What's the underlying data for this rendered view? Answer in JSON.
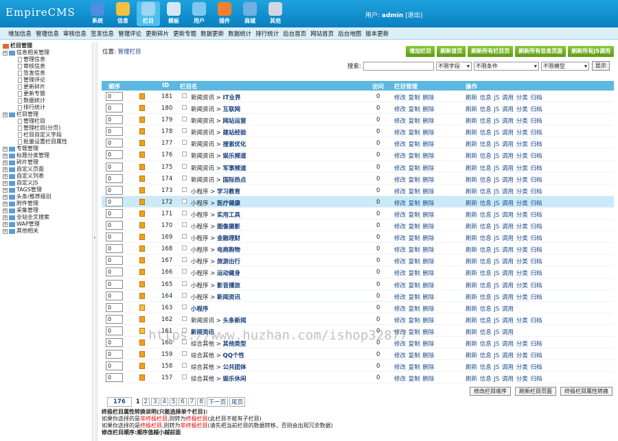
{
  "logo": "EmpireCMS",
  "topnav": [
    {
      "label": "系统",
      "color": "#4a8fe0"
    },
    {
      "label": "信息",
      "color": "#f0c040"
    },
    {
      "label": "栏目",
      "color": "#9dd5f3",
      "active": true
    },
    {
      "label": "模板",
      "color": "#d6e8f5"
    },
    {
      "label": "用户",
      "color": "#7ec8f0"
    },
    {
      "label": "插件",
      "color": "#f08030"
    },
    {
      "label": "商城",
      "color": "#70b0e0"
    },
    {
      "label": "其他",
      "color": "#cfd8e0"
    }
  ],
  "user": {
    "prefix": "用户:",
    "name": "admin",
    "logout": "[退出]"
  },
  "subnav": [
    "增加信息",
    "管理信息",
    "审核信息",
    "签发信息",
    "管理评论",
    "更新碎片",
    "更新专题",
    "数据更新",
    "数据统计",
    "排行统计",
    "后台首页",
    "网站首页",
    "后台地图",
    "版本更新"
  ],
  "sidebar": [
    {
      "t": "栏目管理",
      "lvl": "root"
    },
    {
      "t": "信息相关管理",
      "lvl": "grp"
    },
    {
      "t": "管理信息",
      "lvl": "sub"
    },
    {
      "t": "审核信息",
      "lvl": "sub"
    },
    {
      "t": "签发信息",
      "lvl": "sub"
    },
    {
      "t": "管理评论",
      "lvl": "sub"
    },
    {
      "t": "更新碎片",
      "lvl": "sub"
    },
    {
      "t": "更新专题",
      "lvl": "sub"
    },
    {
      "t": "数据统计",
      "lvl": "sub"
    },
    {
      "t": "排行统计",
      "lvl": "sub"
    },
    {
      "t": "栏目管理",
      "lvl": "grp"
    },
    {
      "t": "管理栏目",
      "lvl": "sub"
    },
    {
      "t": "管理栏目(分页)",
      "lvl": "sub"
    },
    {
      "t": "栏目自定义字段",
      "lvl": "sub"
    },
    {
      "t": "批量设置栏目属性",
      "lvl": "sub"
    },
    {
      "t": "专题管理",
      "lvl": "grp"
    },
    {
      "t": "标题分类管理",
      "lvl": "grp"
    },
    {
      "t": "碎片管理",
      "lvl": "grp"
    },
    {
      "t": "自定义页面",
      "lvl": "grp"
    },
    {
      "t": "自定义列表",
      "lvl": "grp"
    },
    {
      "t": "自定义JS",
      "lvl": "grp"
    },
    {
      "t": "TAGS管理",
      "lvl": "grp"
    },
    {
      "t": "头条/推荐级别",
      "lvl": "grp"
    },
    {
      "t": "附件管理",
      "lvl": "grp"
    },
    {
      "t": "采集管理",
      "lvl": "grp"
    },
    {
      "t": "全站全文搜索",
      "lvl": "grp"
    },
    {
      "t": "WAP管理",
      "lvl": "grp"
    },
    {
      "t": "其他相关",
      "lvl": "grp"
    }
  ],
  "crumb": {
    "prefix": "位置:",
    "link": "管理栏目"
  },
  "toolbar": [
    "增加栏目",
    "刷新首页",
    "刷新所有栏目页",
    "刷新所有信息页面",
    "刷新所有JS调用"
  ],
  "search": {
    "label": "搜索:",
    "field": "不限字段",
    "cond": "不限条件",
    "model": "不限模型",
    "button": "显示"
  },
  "columns": {
    "order": "顺序",
    "id": "ID",
    "name": "栏目名",
    "visits": "访问",
    "manage": "栏目管理",
    "ops": "操作"
  },
  "rows": [
    {
      "order": "0",
      "id": "181",
      "parent": "新闻资讯",
      "name": "IT业界",
      "count": "0",
      "ops": "刷新 信息 JS 调用 分类 归档"
    },
    {
      "order": "0",
      "id": "180",
      "parent": "新闻资讯",
      "name": "互联网",
      "count": "0",
      "ops": "刷新 信息 JS 调用 分类 归档"
    },
    {
      "order": "0",
      "id": "179",
      "parent": "新闻资讯",
      "name": "网站运营",
      "count": "0",
      "ops": "刷新 信息 JS 调用 分类 归档"
    },
    {
      "order": "0",
      "id": "178",
      "parent": "新闻资讯",
      "name": "建站经验",
      "count": "0",
      "ops": "刷新 信息 JS 调用 分类 归档"
    },
    {
      "order": "0",
      "id": "177",
      "parent": "新闻资讯",
      "name": "搜索优化",
      "count": "0",
      "ops": "刷新 信息 JS 调用 分类 归档"
    },
    {
      "order": "0",
      "id": "176",
      "parent": "新闻资讯",
      "name": "娱乐频道",
      "count": "0",
      "ops": "刷新 信息 JS 调用 分类 归档"
    },
    {
      "order": "0",
      "id": "175",
      "parent": "新闻资讯",
      "name": "军事频道",
      "count": "0",
      "ops": "刷新 信息 JS 调用 分类 归档"
    },
    {
      "order": "0",
      "id": "174",
      "parent": "新闻资讯",
      "name": "国际热点",
      "count": "0",
      "ops": "刷新 信息 JS 调用 分类 归档"
    },
    {
      "order": "0",
      "id": "173",
      "parent": "小程序",
      "name": "学习教育",
      "count": "0",
      "ops": "刷新 信息 JS 调用 分类 归档"
    },
    {
      "order": "0",
      "id": "172",
      "parent": "小程序",
      "name": "医疗健康",
      "count": "0",
      "ops": "刷新 信息 JS 调用 分类 归档",
      "hl": true
    },
    {
      "order": "0",
      "id": "171",
      "parent": "小程序",
      "name": "实用工具",
      "count": "0",
      "ops": "刷新 信息 JS 调用 分类 归档"
    },
    {
      "order": "0",
      "id": "170",
      "parent": "小程序",
      "name": "图像摄影",
      "count": "0",
      "ops": "刷新 信息 JS 调用 分类 归档"
    },
    {
      "order": "0",
      "id": "169",
      "parent": "小程序",
      "name": "金融理财",
      "count": "0",
      "ops": "刷新 信息 JS 调用 分类 归档"
    },
    {
      "order": "0",
      "id": "168",
      "parent": "小程序",
      "name": "电商购物",
      "count": "0",
      "ops": "刷新 信息 JS 调用 分类 归档"
    },
    {
      "order": "0",
      "id": "167",
      "parent": "小程序",
      "name": "旅游出行",
      "count": "0",
      "ops": "刷新 信息 JS 调用 分类 归档"
    },
    {
      "order": "0",
      "id": "166",
      "parent": "小程序",
      "name": "运动健身",
      "count": "0",
      "ops": "刷新 信息 JS 调用 分类 归档"
    },
    {
      "order": "0",
      "id": "165",
      "parent": "小程序",
      "name": "影音播放",
      "count": "0",
      "ops": "刷新 信息 JS 调用 分类 归档"
    },
    {
      "order": "0",
      "id": "164",
      "parent": "小程序",
      "name": "新闻资讯",
      "count": "0",
      "ops": "刷新 信息 JS 调用 分类 归档"
    },
    {
      "order": "0",
      "id": "163",
      "parent": "",
      "name": "小程序",
      "count": "0",
      "ops": "刷新 信息 JS 调用",
      "folder": true
    },
    {
      "order": "0",
      "id": "162",
      "parent": "新闻资讯",
      "name": "头条新闻",
      "count": "0",
      "ops": "刷新 信息 JS 调用 分类 归档"
    },
    {
      "order": "0",
      "id": "161",
      "parent": "",
      "name": "新闻资讯",
      "count": "0",
      "ops": "刷新 信息 JS 调用",
      "folder": true
    },
    {
      "order": "0",
      "id": "160",
      "parent": "综合其他",
      "name": "其他类型",
      "count": "0",
      "ops": "刷新 信息 JS 调用 分类 归档"
    },
    {
      "order": "0",
      "id": "159",
      "parent": "综合其他",
      "name": "QQ个性",
      "count": "0",
      "ops": "刷新 信息 JS 调用 分类 归档"
    },
    {
      "order": "0",
      "id": "158",
      "parent": "综合其他",
      "name": "公共团体",
      "count": "0",
      "ops": "刷新 信息 JS 调用 分类 归档"
    },
    {
      "order": "0",
      "id": "157",
      "parent": "综合其他",
      "name": "娱乐休闲",
      "count": "0",
      "ops": "刷新 信息 JS 调用 分类 归档"
    }
  ],
  "manage_links": "修改 复制 删除",
  "pager": {
    "total": "176",
    "current": "1",
    "pages": [
      "2",
      "3",
      "4",
      "5",
      "6",
      "7",
      "8"
    ],
    "next": "下一页",
    "last": "尾页"
  },
  "bottom_buttons": [
    "修改栏目顺序",
    "刷新栏目页面",
    "终极栏目属性转换"
  ],
  "notes": {
    "title": "终极栏目属性转换说明(只能选择单个栏目):",
    "l1a": "如果你选择的是",
    "l1b": "非终极栏目",
    "l1c": ",则转为",
    "l1d": "终极栏目",
    "l1e": "(此栏目不能有子栏目)",
    "l2a": "如果你选择的是",
    "l2b": "终极栏目",
    "l2c": ",则转为",
    "l2d": "非终极栏目",
    "l2e": "(请先把当前栏目的数据转移，否则会出现冗余数据)",
    "l3": "修改栏目顺序:顺序值越小越前面"
  },
  "watermark": "https://www.huzhan.com/ishop32877"
}
